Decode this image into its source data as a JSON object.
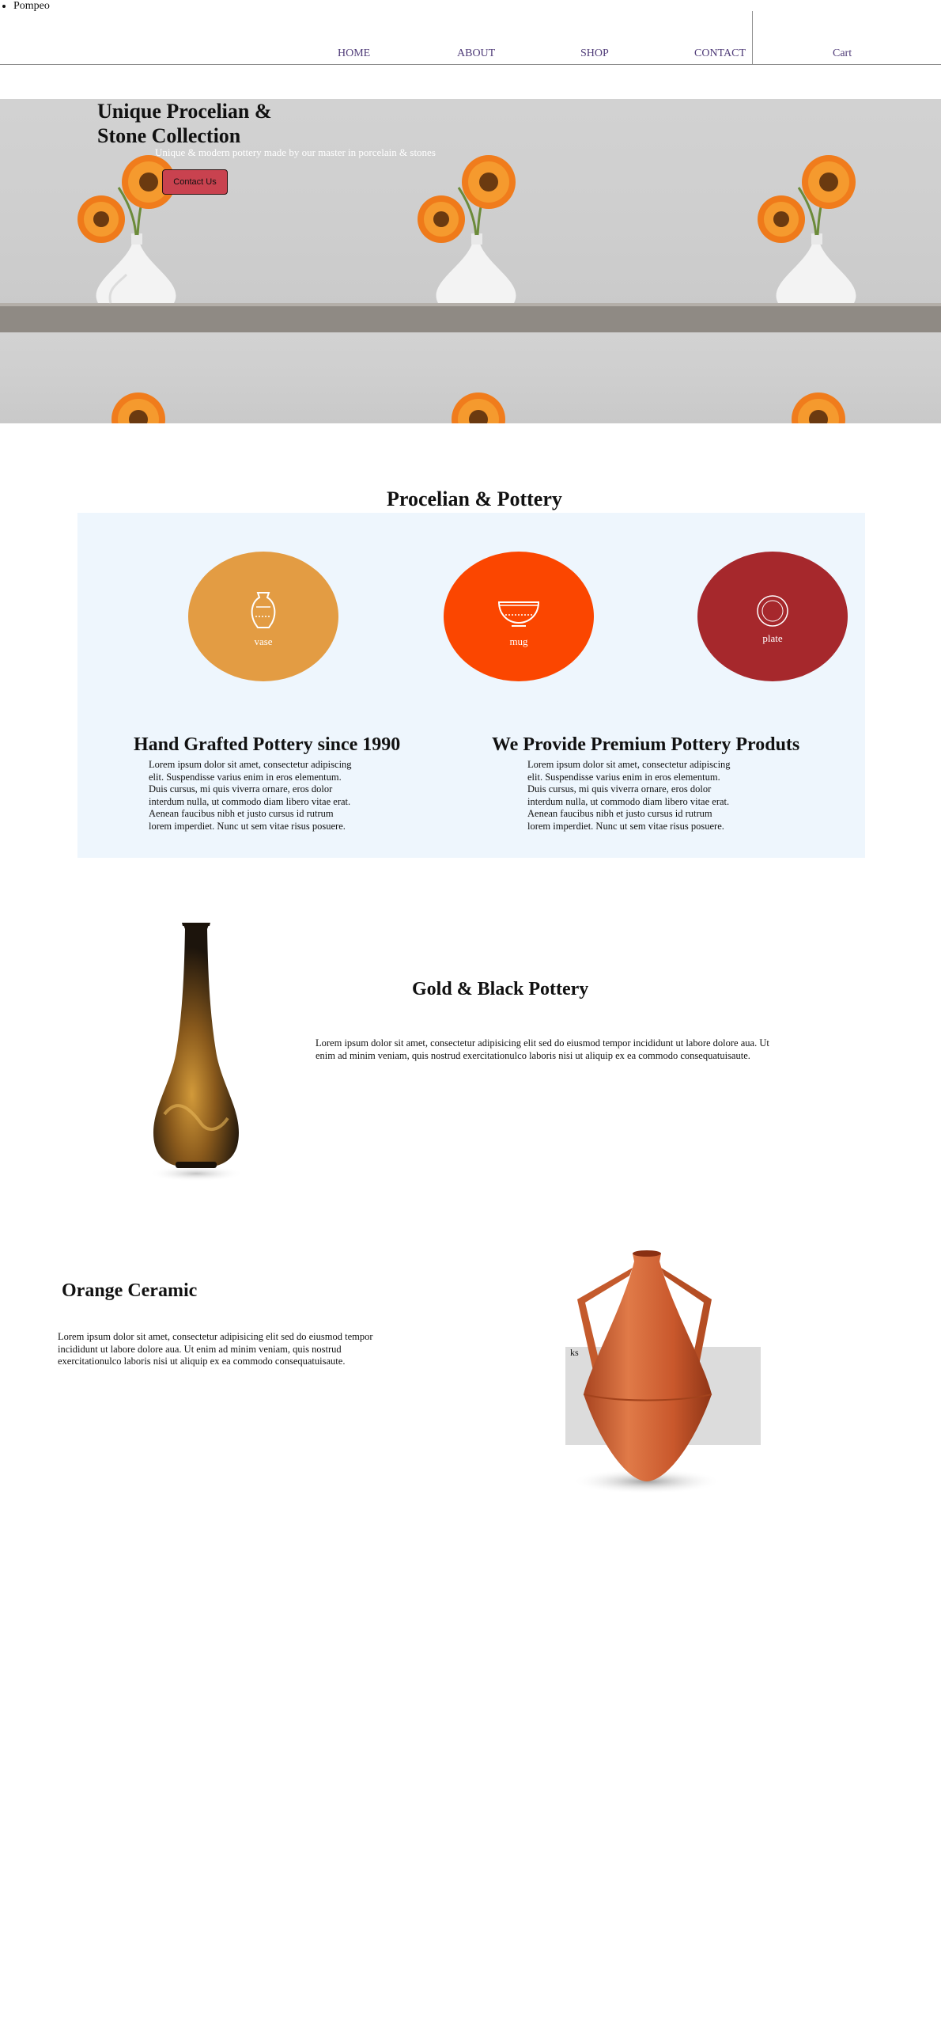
{
  "brand": {
    "name": "Pompeo"
  },
  "nav": {
    "home": "HOME",
    "about": "ABOUT",
    "shop": "SHOP",
    "contact": "CONTACT",
    "cart": "Cart"
  },
  "hero": {
    "title_line1": "Unique Procelian &",
    "title_line2": "Stone Collection",
    "subtitle": "Unique & modern pottery made by our master in porcelain & stones",
    "cta_label": "Contact Us"
  },
  "pottery": {
    "title": "Procelian & Pottery",
    "categories": [
      {
        "label": "vase",
        "color": "#e39c43",
        "icon": "vase-icon"
      },
      {
        "label": "mug",
        "color": "#fb4600",
        "icon": "bowl-icon"
      },
      {
        "label": "plate",
        "color": "#a6282c",
        "icon": "plate-icon"
      }
    ],
    "features": [
      {
        "title": "Hand Grafted Pottery since 1990",
        "text": "Lorem ipsum dolor sit amet, consectetur adipiscing elit. Suspendisse varius enim in eros elementum. Duis cursus, mi quis viverra ornare, eros dolor interdum nulla, ut commodo diam libero vitae erat. Aenean faucibus nibh et justo cursus id rutrum lorem imperdiet. Nunc ut sem vitae risus posuere."
      },
      {
        "title": "We Provide Premium Pottery Produts",
        "text": "Lorem ipsum dolor sit amet, consectetur adipiscing elit. Suspendisse varius enim in eros elementum. Duis cursus, mi quis viverra ornare, eros dolor interdum nulla, ut commodo diam libero vitae erat. Aenean faucibus nibh et justo cursus id rutrum lorem imperdiet. Nunc ut sem vitae risus posuere."
      }
    ]
  },
  "gold": {
    "title": "Gold & Black Pottery",
    "text": "Lorem ipsum dolor sit amet, consectetur adipisicing elit sed do eiusmod tempor incididunt ut labore dolore aua. Ut enim ad minim veniam, quis nostrud exercitationulco laboris nisi ut aliquip ex ea commodo consequatuisaute."
  },
  "orange": {
    "title": "Orange Ceramic",
    "text": "Lorem ipsum dolor sit amet, consectetur adipisicing elit sed do eiusmod tempor incididunt ut labore dolore aua. Ut enim ad minim veniam, quis nostrud exercitationulco laboris nisi ut aliquip ex ea commodo consequatuisaute.",
    "caption": "ks"
  }
}
